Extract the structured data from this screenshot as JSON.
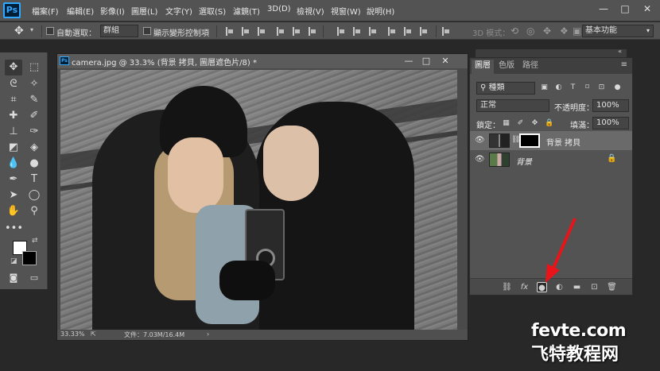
{
  "app": {
    "logo": "Ps"
  },
  "menubar": {
    "items": [
      "檔案(F)",
      "編輯(E)",
      "影像(I)",
      "圖層(L)",
      "文字(Y)",
      "選取(S)",
      "濾鏡(T)",
      "3D(D)",
      "檢視(V)",
      "視窗(W)",
      "說明(H)"
    ],
    "window_controls": [
      "—",
      "□",
      "✕"
    ]
  },
  "options_bar": {
    "auto_select_label": "自動選取：",
    "auto_select_value": "群組",
    "show_transform_label": "顯示變形控制項",
    "mode_3d_label": "3D 模式：",
    "workspace_value": "基本功能"
  },
  "document": {
    "title": "camera.jpg @ 33.3% (背景 拷貝, 圖層遮色片/8) *",
    "zoom": "33.33%",
    "file_info": "文件：7.03M/16.4M"
  },
  "layers_panel": {
    "tabs": [
      "圖層",
      "色版",
      "路徑"
    ],
    "active_tab": "圖層",
    "filter_value": "種類",
    "blend_mode": "正常",
    "opacity_label": "不透明度：",
    "opacity_value": "100%",
    "lock_label": "鎖定：",
    "fill_label": "填滿：",
    "fill_value": "100%",
    "layers": [
      {
        "name": "背景 拷貝",
        "visible": true,
        "active": true,
        "has_mask": true
      },
      {
        "name": "背景",
        "visible": true,
        "active": false,
        "locked": true
      }
    ]
  },
  "watermark": {
    "line1": "fevte.com",
    "line2": "飞特教程网"
  },
  "colors": {
    "ps_blue": "#31a8ff",
    "arrow_red": "#e8141a",
    "panel_bg": "#535353"
  }
}
